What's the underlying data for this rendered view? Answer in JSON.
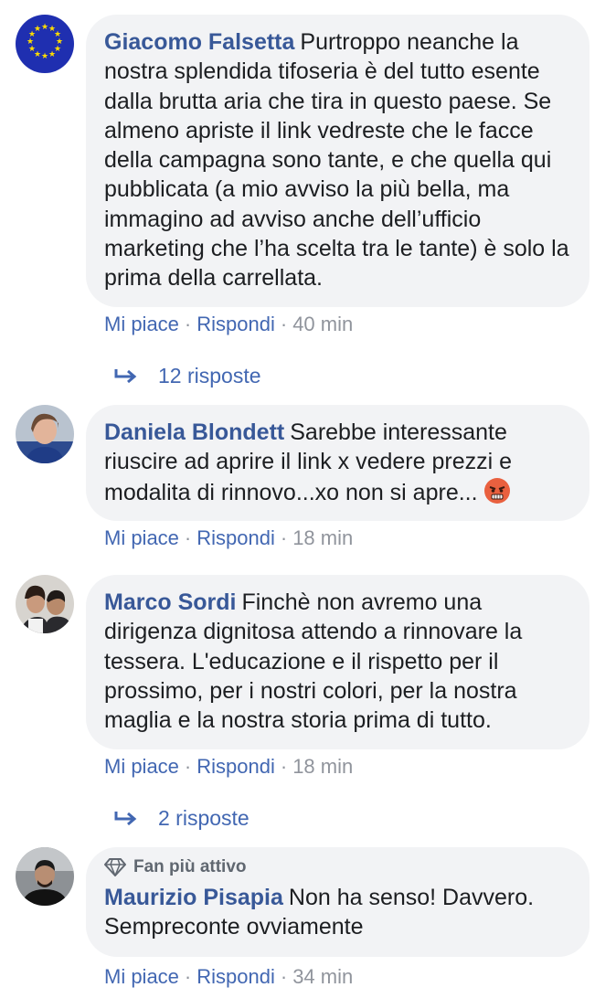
{
  "comments": [
    {
      "author": "Giacomo Falsetta",
      "text": "Purtroppo neanche la nostra splendida tifoseria è del tutto esente dalla brutta aria che tira in questo paese. Se almeno apriste il link vedreste che le facce della campagna sono tante, e che quella qui pubblicata (a mio avviso la più bella, ma immagino ad avviso anche dell’ufficio marketing che l’ha scelta tra le tante) è solo la prima della carrellata.",
      "like": "Mi piace",
      "reply": "Rispondi",
      "time": "40 min",
      "replies": "12 risposte",
      "avatar_icon": "eu-flag-avatar"
    },
    {
      "author": "Daniela Blondett",
      "text": "Sarebbe interessante riuscire ad aprire il link x vedere prezzi e modalita di rinnovo...xo non si apre...",
      "emoji": "angry-face-icon",
      "like": "Mi piace",
      "reply": "Rispondi",
      "time": "18 min"
    },
    {
      "author": "Marco Sordi",
      "text": "Finchè non avremo una dirigenza dignitosa attendo a rinnovare la tessera. L'educazione e il rispetto per il prossimo, per i nostri colori, per la nostra maglia e la nostra storia prima di tutto.",
      "like": "Mi piace",
      "reply": "Rispondi",
      "time": "18 min",
      "replies": "2 risposte"
    },
    {
      "badge": "Fan più attivo",
      "badge_icon": "diamond-icon",
      "author": "Maurizio Pisapia",
      "text": "Non ha senso! Davvero. Sempreconte ovviamente",
      "like": "Mi piace",
      "reply": "Rispondi",
      "time": "34 min"
    }
  ],
  "separator": "·",
  "colors": {
    "author": "#385898",
    "link": "#4267b2",
    "meta": "#90949c",
    "bubble": "#f2f3f5"
  }
}
